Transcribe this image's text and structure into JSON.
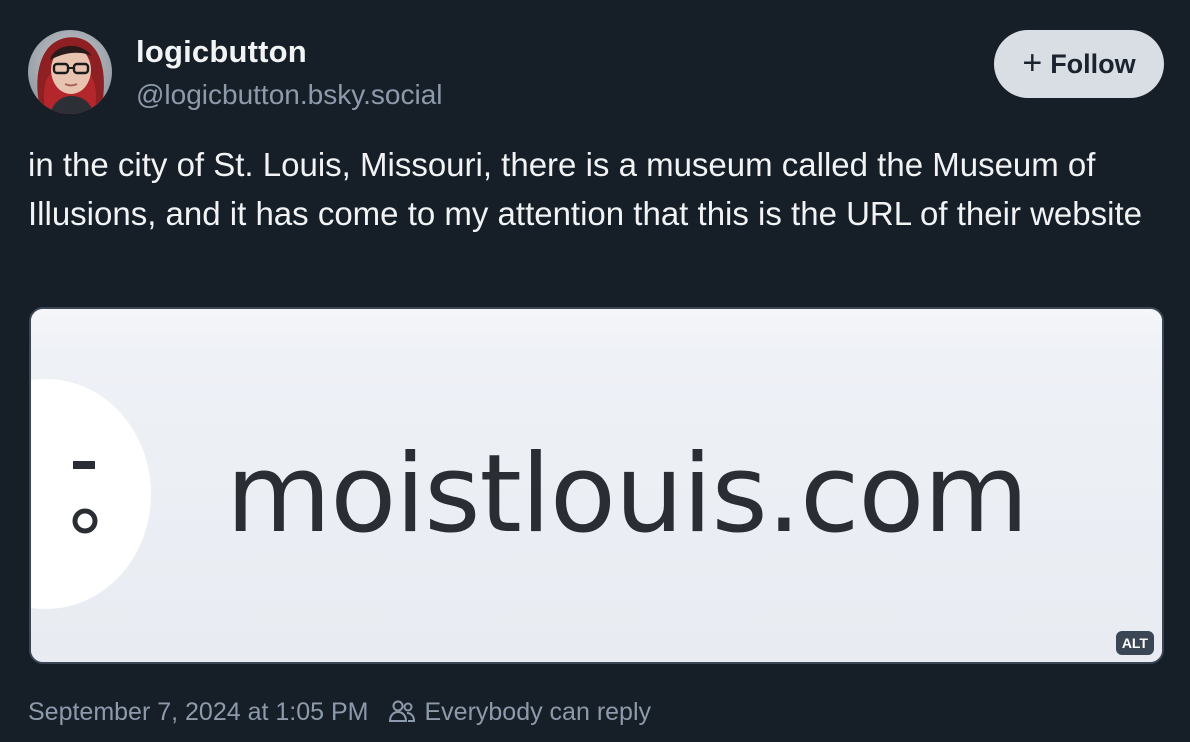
{
  "post": {
    "author": {
      "display_name": "logicbutton",
      "handle": "@logicbutton.bsky.social",
      "avatar_icon": "avatar-photo"
    },
    "follow_button": {
      "icon": "plus-icon",
      "label": "Follow"
    },
    "text": "in the city of St. Louis, Missouri, there is a museum called the Museum of Illusions, and it has come to my attention that this is the URL of their website",
    "image": {
      "url_text": "moistlouis.com",
      "alt_badge": "ALT"
    },
    "footer": {
      "timestamp": "September 7, 2024 at 1:05 PM",
      "reply_icon": "people-icon",
      "reply_setting": "Everybody can reply"
    }
  },
  "colors": {
    "background": "#161e27",
    "primary_text": "#f1f3f5",
    "secondary_text": "#8d9aab",
    "follow_button_bg": "#d9dee5"
  }
}
